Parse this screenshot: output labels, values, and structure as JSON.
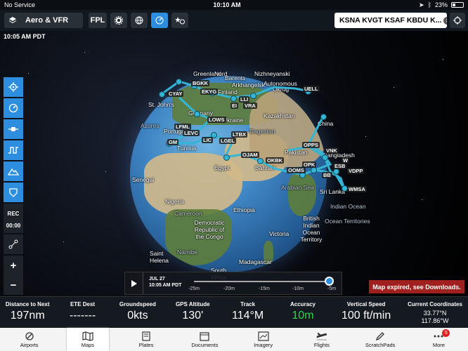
{
  "status_bar": {
    "carrier": "No Service",
    "time": "10:10 AM",
    "battery": "23%"
  },
  "toolbar": {
    "profile_label": "Aero & VFR",
    "fpl_label": "FPL",
    "route": "KSNA KVGT KSAF KBDU K..."
  },
  "map": {
    "time_label": "10:05 AM PDT",
    "labels": {
      "greenland": "Greenland",
      "nord": "Nord",
      "nizhneyansk": "Nizhneyanski",
      "barents": "Barents",
      "arkhangelsk": "Arkhangelsk",
      "autonomous": "Autonomous",
      "okrug": "Okrug",
      "finland": "Finland",
      "sjohns": "St. John's",
      "germany": "Germany",
      "ukraine": "Ukraine",
      "kazakhstan": "Kazakhstan",
      "azores": "Azores",
      "portugal": "Portugal",
      "tunisia": "Tunisia",
      "dagestan": "Dagestan",
      "china": "China",
      "bahrain": "Bahrain",
      "pakistan": "Pakistan",
      "bangladesh": "Bangladesh",
      "egypt": "Egypt",
      "senegal": "Senegal",
      "nigeria": "Nigeria",
      "ethiopia": "Ethiopia",
      "arabian_sea": "Arabian Sea",
      "sri_lanka": "Sri Lanka",
      "indian_ocean": "Indian Ocean",
      "drc": "Democratic Republic of the Congo",
      "victoria": "Victoria",
      "biot": "British Indian Ocean Territory",
      "biot2": "Ocean Territories",
      "saint_helena": "Saint Helena",
      "namibia": "Namibe",
      "madagascar": "Madagascar",
      "south_africa": "South Africa",
      "cameroon": "Cameroon"
    },
    "airports": [
      "BGKK",
      "CYAY",
      "EKYG",
      "LLI",
      "EI",
      "VRA",
      "UELL",
      "LOWS",
      "LFML",
      "LEVC",
      "LTBX",
      "GM",
      "LIC",
      "LGEL",
      "OJAM",
      "OKBK",
      "OPPS",
      "VNK",
      "OOMS",
      "OPK",
      "VDPP",
      "WMSA",
      "BB",
      "ESB",
      "W"
    ]
  },
  "timeline": {
    "date": "JUL 27",
    "time": "10:05 AM PDT",
    "ticks": [
      "-25m",
      "-20m",
      "-15m",
      "-10m",
      "-5m"
    ],
    "position": 0.98
  },
  "expired_banner": "Map expired, see Downloads.",
  "instruments": [
    {
      "label": "Distance to Next",
      "value": "197nm"
    },
    {
      "label": "ETE Dest",
      "value": "-------"
    },
    {
      "label": "Groundspeed",
      "value": "0kts"
    },
    {
      "label": "GPS Altitude",
      "value": "130'"
    },
    {
      "label": "Track",
      "value": "114°M"
    },
    {
      "label": "Accuracy",
      "value": "10m"
    },
    {
      "label": "Vertical Speed",
      "value": "100 ft/min"
    },
    {
      "label": "Current Coordinates",
      "lat": "33.77°N",
      "lon": "117.86°W"
    }
  ],
  "sidebar": {
    "rec_label": "REC",
    "timer": "00:00"
  },
  "tabs": {
    "airports": "Airports",
    "maps": "Maps",
    "plates": "Plates",
    "documents": "Documents",
    "imagery": "Imagery",
    "flights": "Flights",
    "scratchpads": "ScratchPads",
    "more": "More",
    "more_badge": "5"
  },
  "colors": {
    "accent": "#2d8ee0",
    "airport": "#35b5d6",
    "alert": "#a0201f",
    "accuracy": "#2cd64a"
  }
}
